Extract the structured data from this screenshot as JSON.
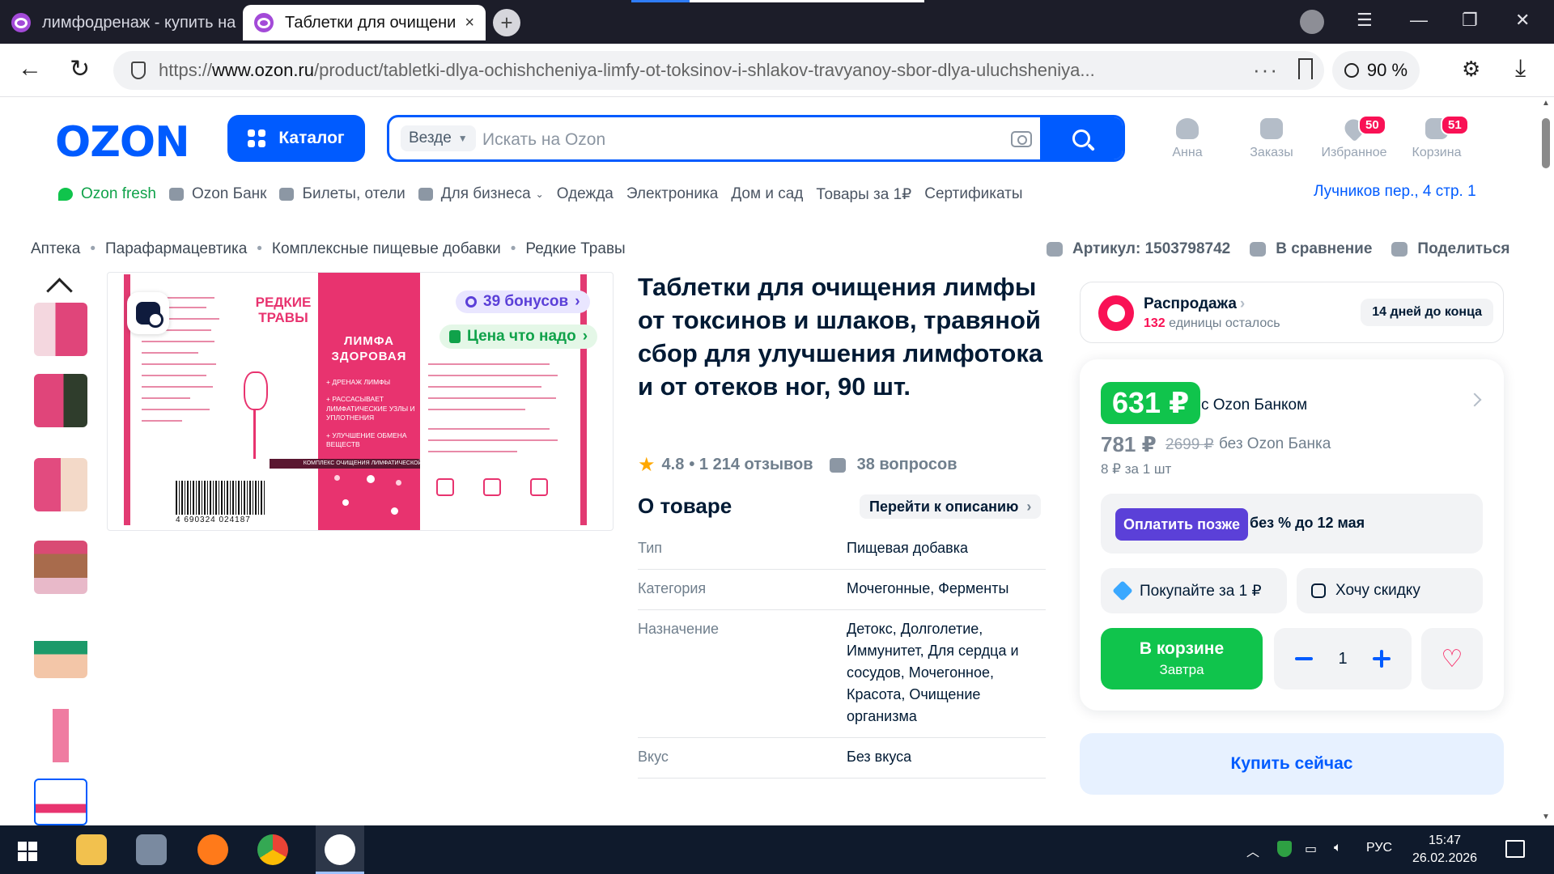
{
  "browser": {
    "tabs": [
      {
        "title": "лимфодренаж - купить на"
      },
      {
        "title": "Таблетки для очищени",
        "close": "×"
      }
    ],
    "new_tab": "+",
    "url_prefix": "https://",
    "url_domain": "www.ozon.ru",
    "url_path": "/product/tabletki-dlya-ochishcheniya-limfy-ot-toksinov-i-shlakov-travyanoy-sbor-dlya-uluchsheniya...",
    "url_more": "···",
    "zoom": "90 %"
  },
  "header": {
    "logo": "OZON",
    "catalog": "Каталог",
    "search_scope": "Везде",
    "search_placeholder": "Искать на Ozon",
    "user": "Анна",
    "orders": "Заказы",
    "favorites": "Избранное",
    "favorites_count": "50",
    "cart": "Корзина",
    "cart_count": "51"
  },
  "subnav": {
    "items": [
      "Ozon fresh",
      "Ozon Банк",
      "Билеты, отели",
      "Для бизнеса",
      "Одежда",
      "Электроника",
      "Дом и сад",
      "Товары за 1₽",
      "Сертификаты"
    ],
    "address": "Лучников пер., 4 стр. 1"
  },
  "breadcrumbs": [
    "Аптека",
    "Парафармацевтика",
    "Комплексные пищевые добавки",
    "Редкие Травы"
  ],
  "actions": {
    "article": "Артикул: 1503798742",
    "compare": "В сравнение",
    "share": "Поделиться"
  },
  "gallery": {
    "badge_bonus": "39 бонусов",
    "badge_price": "Цена что надо",
    "pkg_brand": "РЕДКИЕ ТРАВЫ",
    "pkg_title": "ЛИМФА ЗДОРОВАЯ",
    "pkg_bullets": [
      "+ ДРЕНАЖ ЛИМФЫ",
      "+ РАССАСЫВАЕТ ЛИМФАТИЧЕСКИЕ УЗЛЫ И УПЛОТНЕНИЯ",
      "+ УЛУЧШЕНИЕ ОБМЕНА ВЕЩЕСТВ"
    ],
    "pkg_bar": "КОМПЛЕКС ОЧИЩЕНИЯ ЛИМФАТИЧЕСКОЙ СИСТЕМЫ",
    "barcode_number": "4 690324 024187"
  },
  "product": {
    "title": "Таблетки для очищения лимфы от токсинов и шлаков, травяной сбор для улучшения лимфотока и от отеков ног, 90 шт.",
    "rating": "4.8",
    "reviews": "• 1 214 отзывов",
    "questions": "38 вопросов",
    "about_title": "О товаре",
    "goto_description": "Перейти к описанию",
    "specs": [
      {
        "k": "Тип",
        "v": "Пищевая добавка"
      },
      {
        "k": "Категория",
        "v": "Мочегонные, Ферменты"
      },
      {
        "k": "Назначение",
        "v": "Детокс, Долголетие, Иммунитет, Для сердца и сосудов, Мочегонное, Красота, Очищение организма"
      },
      {
        "k": "Вкус",
        "v": "Без вкуса"
      }
    ]
  },
  "sale": {
    "title": "Распродажа",
    "left_count": "132",
    "left_text": " единицы осталось",
    "days": "14 дней до конца"
  },
  "price": {
    "bank_price": "631 ₽",
    "bank_label": "с Ozon Банком",
    "regular": "781 ₽",
    "old": "2699 ₽",
    "regular_label": "без Ozon Банка",
    "per_unit": "8 ₽ за 1 шт",
    "pay_later_btn": "Оплатить позже",
    "pay_later_text": "без % до 12 мая",
    "chip_1": "Покупайте за 1 ₽",
    "chip_2": "Хочу скидку",
    "cart_btn": "В корзине",
    "cart_sub": "Завтра",
    "qty": "1",
    "buy_now": "Купить сейчас"
  },
  "taskbar": {
    "lang": "РУС",
    "time": "15:47",
    "date": "26.02.2026"
  }
}
